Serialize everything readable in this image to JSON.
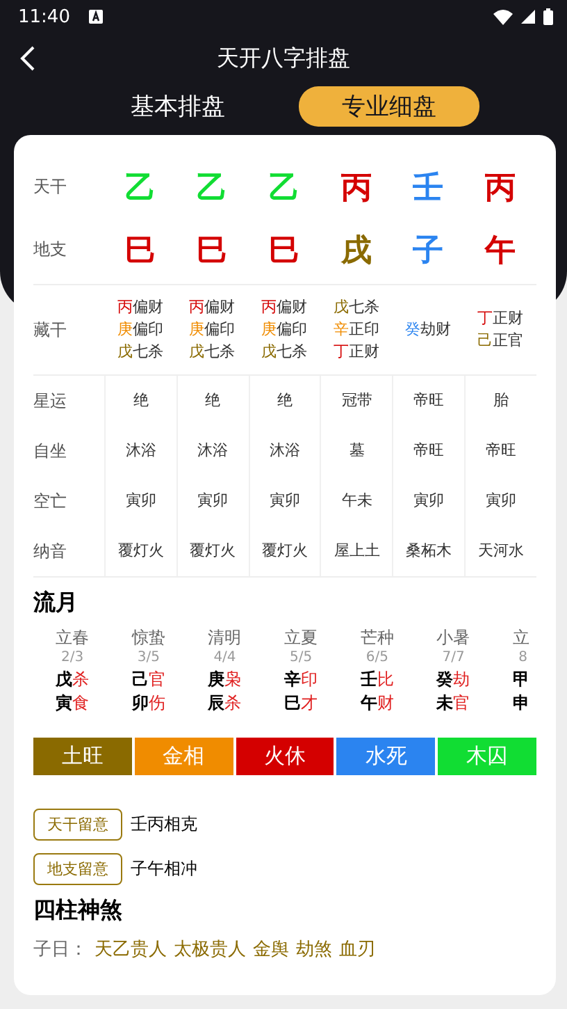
{
  "status_bar": {
    "time": "11:40"
  },
  "header": {
    "title": "天开八字排盘"
  },
  "tabs": [
    {
      "label": "基本排盘",
      "selected": false
    },
    {
      "label": "专业细盘",
      "selected": true
    }
  ],
  "pillars": {
    "rows": [
      {
        "label": "天干",
        "chars": [
          {
            "text": "乙",
            "color": "#11dd33"
          },
          {
            "text": "乙",
            "color": "#11dd33"
          },
          {
            "text": "乙",
            "color": "#11dd33"
          },
          {
            "text": "丙",
            "color": "#d40000"
          },
          {
            "text": "壬",
            "color": "#2b84f0"
          },
          {
            "text": "丙",
            "color": "#d40000"
          }
        ]
      },
      {
        "label": "地支",
        "chars": [
          {
            "text": "巳",
            "color": "#d40000"
          },
          {
            "text": "巳",
            "color": "#d40000"
          },
          {
            "text": "巳",
            "color": "#d40000"
          },
          {
            "text": "戌",
            "color": "#8a6a00"
          },
          {
            "text": "子",
            "color": "#2b84f0"
          },
          {
            "text": "午",
            "color": "#d40000"
          }
        ]
      }
    ]
  },
  "hidden_stems": {
    "label": "藏干",
    "cells": [
      [
        {
          "stem": "丙",
          "color": "#d40000",
          "god": "偏财"
        },
        {
          "stem": "庚",
          "color": "#f08c00",
          "god": "偏印"
        },
        {
          "stem": "戊",
          "color": "#8a6a00",
          "god": "七杀"
        }
      ],
      [
        {
          "stem": "丙",
          "color": "#d40000",
          "god": "偏财"
        },
        {
          "stem": "庚",
          "color": "#f08c00",
          "god": "偏印"
        },
        {
          "stem": "戊",
          "color": "#8a6a00",
          "god": "七杀"
        }
      ],
      [
        {
          "stem": "丙",
          "color": "#d40000",
          "god": "偏财"
        },
        {
          "stem": "庚",
          "color": "#f08c00",
          "god": "偏印"
        },
        {
          "stem": "戊",
          "color": "#8a6a00",
          "god": "七杀"
        }
      ],
      [
        {
          "stem": "戊",
          "color": "#8a6a00",
          "god": "七杀"
        },
        {
          "stem": "辛",
          "color": "#f08c00",
          "god": "正印"
        },
        {
          "stem": "丁",
          "color": "#d40000",
          "god": "正财"
        }
      ],
      [
        {
          "stem": "癸",
          "color": "#2b84f0",
          "god": "劫财"
        }
      ],
      [
        {
          "stem": "丁",
          "color": "#d40000",
          "god": "正财"
        },
        {
          "stem": "己",
          "color": "#8a6a00",
          "god": "正官"
        }
      ]
    ]
  },
  "details": [
    {
      "label": "星运",
      "values": [
        "绝",
        "绝",
        "绝",
        "冠带",
        "帝旺",
        "胎"
      ]
    },
    {
      "label": "自坐",
      "values": [
        "沐浴",
        "沐浴",
        "沐浴",
        "墓",
        "帝旺",
        "帝旺"
      ]
    },
    {
      "label": "空亡",
      "values": [
        "寅卯",
        "寅卯",
        "寅卯",
        "午未",
        "寅卯",
        "寅卯"
      ]
    },
    {
      "label": "纳音",
      "values": [
        "覆灯火",
        "覆灯火",
        "覆灯火",
        "屋上土",
        "桑柘木",
        "天河水"
      ]
    }
  ],
  "monthly": {
    "title": "流月",
    "months": [
      {
        "term": "立春",
        "date": "2/3",
        "stem": "戊",
        "stem_god": "杀",
        "branch": "寅",
        "branch_god": "食"
      },
      {
        "term": "惊蛰",
        "date": "3/5",
        "stem": "己",
        "stem_god": "官",
        "branch": "卯",
        "branch_god": "伤"
      },
      {
        "term": "清明",
        "date": "4/4",
        "stem": "庚",
        "stem_god": "枭",
        "branch": "辰",
        "branch_god": "杀"
      },
      {
        "term": "立夏",
        "date": "5/5",
        "stem": "辛",
        "stem_god": "印",
        "branch": "巳",
        "branch_god": "才"
      },
      {
        "term": "芒种",
        "date": "6/5",
        "stem": "壬",
        "stem_god": "比",
        "branch": "午",
        "branch_god": "财"
      },
      {
        "term": "小暑",
        "date": "7/7",
        "stem": "癸",
        "stem_god": "劫",
        "branch": "未",
        "branch_god": "官"
      },
      {
        "term": "立",
        "date": "8",
        "stem": "甲",
        "branch": "申"
      }
    ]
  },
  "elements": [
    {
      "label": "土旺",
      "color": "#8a6a00"
    },
    {
      "label": "金相",
      "color": "#f08c00"
    },
    {
      "label": "火休",
      "color": "#d40000"
    },
    {
      "label": "水死",
      "color": "#2b84f0"
    },
    {
      "label": "木囚",
      "color": "#11dd33"
    }
  ],
  "notes": [
    {
      "tag": "天干留意",
      "text": "壬丙相克"
    },
    {
      "tag": "地支留意",
      "text": "子午相冲"
    }
  ],
  "shensha": {
    "title": "四柱神煞",
    "lines": [
      {
        "label": "子日：",
        "items": [
          "天乙贵人",
          "太极贵人",
          "金舆",
          "劫煞",
          "血刃"
        ]
      }
    ]
  }
}
